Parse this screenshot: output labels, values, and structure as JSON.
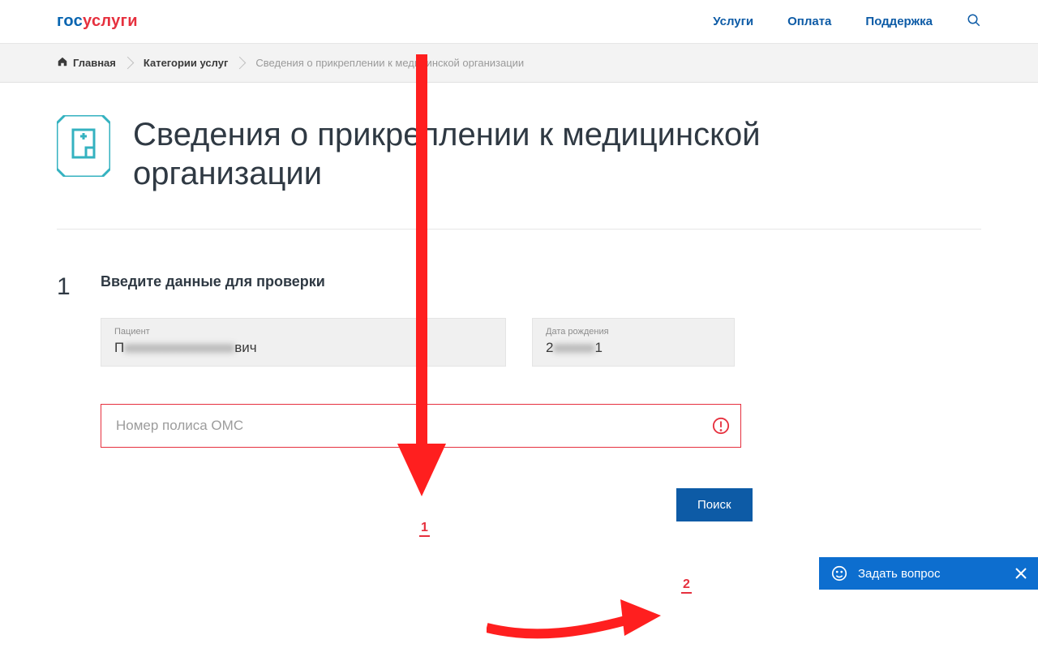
{
  "logo": {
    "part1": "гос",
    "part2": "услуги"
  },
  "nav": {
    "services": "Услуги",
    "payment": "Оплата",
    "support": "Поддержка"
  },
  "breadcrumb": {
    "home": "Главная",
    "categories": "Категории услуг",
    "current": "Сведения о прикреплении к медицинской организации"
  },
  "title": "Сведения о прикреплении к медицинской организации",
  "step": {
    "number": "1",
    "heading": "Введите данные для проверки",
    "patient_label": "Пациент",
    "patient_value_prefix": "П",
    "patient_value_hidden": "xxxxxxxxxxxxxxxx",
    "patient_value_suffix": "вич",
    "dob_label": "Дата рождения",
    "dob_value_prefix": "2",
    "dob_value_hidden": "xxxxxx",
    "dob_value_suffix": "1",
    "oms_placeholder": "Номер полиса ОМС",
    "search_button": "Поиск"
  },
  "annotation": {
    "n1": "1",
    "n2": "2"
  },
  "ask": {
    "label": "Задать вопрос"
  }
}
